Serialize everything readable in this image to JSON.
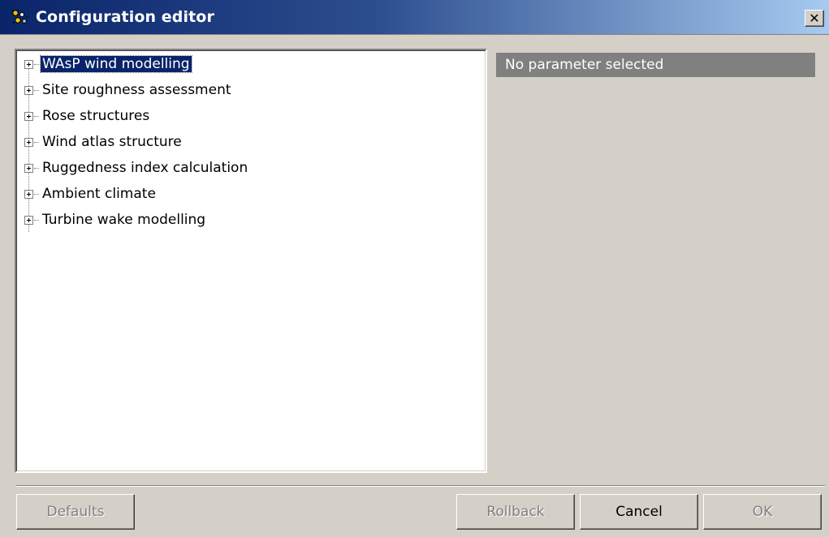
{
  "window": {
    "title": "Configuration editor",
    "close_glyph": "✕",
    "icon": "configuration-app-icon"
  },
  "tree": {
    "items": [
      {
        "label": "WAsP wind modelling",
        "selected": true
      },
      {
        "label": "Site roughness assessment",
        "selected": false
      },
      {
        "label": "Rose structures",
        "selected": false
      },
      {
        "label": "Wind atlas structure",
        "selected": false
      },
      {
        "label": "Ruggedness index calculation",
        "selected": false
      },
      {
        "label": "Ambient climate",
        "selected": false
      },
      {
        "label": "Turbine wake modelling",
        "selected": false
      }
    ]
  },
  "parameter_panel": {
    "header": "No parameter selected"
  },
  "buttons": {
    "defaults": "Defaults",
    "rollback": "Rollback",
    "cancel": "Cancel",
    "ok": "OK"
  },
  "colors": {
    "selection": "#0a246a",
    "panel_header": "#808080",
    "dialog_face": "#d4d0c8"
  }
}
